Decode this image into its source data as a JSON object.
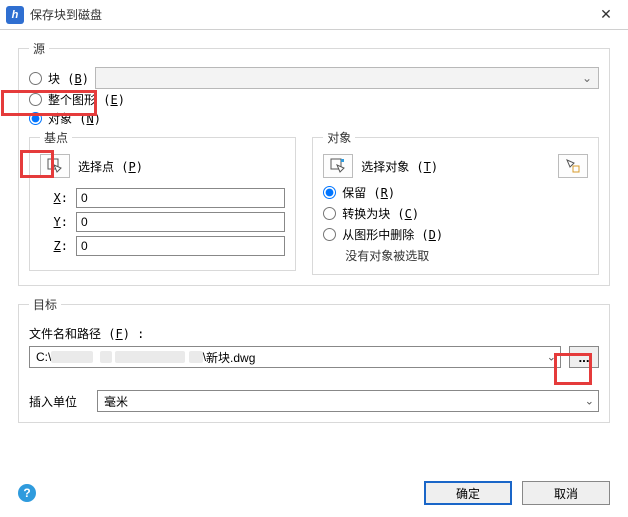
{
  "window": {
    "title": "保存块到磁盘",
    "app_icon_glyph": "h",
    "close_glyph": "✕"
  },
  "source": {
    "legend": "源",
    "block_label": "块",
    "block_accel": "B",
    "entire_label": "整个图形",
    "entire_accel": "E",
    "objects_label": "对象",
    "objects_accel": "N",
    "selected": "objects"
  },
  "basepoint": {
    "legend": "基点",
    "pick_label": "选择点",
    "pick_accel": "P",
    "x_label": "X:",
    "y_label": "Y:",
    "z_label": "Z:",
    "x": "0",
    "y": "0",
    "z": "0"
  },
  "objects": {
    "legend": "对象",
    "select_label": "选择对象",
    "select_accel": "T",
    "retain_label": "保留",
    "retain_accel": "R",
    "convert_label": "转换为块",
    "convert_accel": "C",
    "delete_label": "从图形中删除",
    "delete_accel": "D",
    "status": "没有对象被选取",
    "selected": "retain"
  },
  "target": {
    "legend": "目标",
    "path_label": "文件名和路径",
    "path_accel": "F",
    "path_prefix": "C:\\",
    "path_suffix": "新块.dwg",
    "browse_label": "...",
    "units_label": "插入单位",
    "units_value": "毫米"
  },
  "buttons": {
    "ok": "确定",
    "cancel": "取消",
    "help_glyph": "?"
  },
  "glyphs": {
    "chev_down": "⌄",
    "colon_suffix": " :"
  }
}
